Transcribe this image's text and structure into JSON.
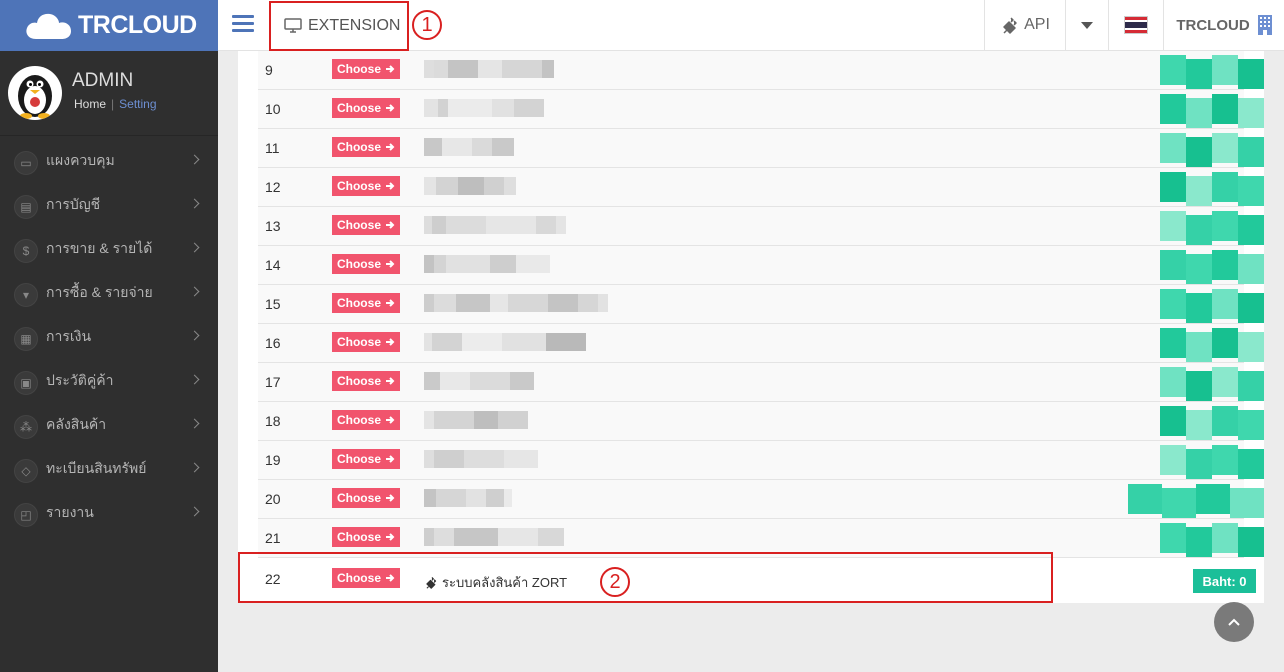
{
  "brand": {
    "logo_text": "TRCLOUD"
  },
  "topbar": {
    "extension_label": "EXTENSION",
    "api_label": "API",
    "user_label": "TRCLOUD"
  },
  "annotations": {
    "callout_1": "1",
    "callout_2": "2"
  },
  "profile": {
    "name": "ADMIN",
    "home_link": "Home",
    "separator": "|",
    "setting_link": "Setting"
  },
  "sidebar": {
    "items": [
      {
        "label": "แผงควบคุม",
        "icon": "monitor-icon"
      },
      {
        "label": "การบัญชี",
        "icon": "book-icon"
      },
      {
        "label": "การขาย & รายได้",
        "icon": "dollar-icon"
      },
      {
        "label": "การซื้อ & รายจ่าย",
        "icon": "cart-icon"
      },
      {
        "label": "การเงิน",
        "icon": "calendar-icon"
      },
      {
        "label": "ประวัติคู่ค้า",
        "icon": "contact-book-icon"
      },
      {
        "label": "คลังสินค้า",
        "icon": "cubes-icon"
      },
      {
        "label": "ทะเบียนสินทรัพย์",
        "icon": "diamond-icon"
      },
      {
        "label": "รายงาน",
        "icon": "report-icon"
      }
    ]
  },
  "extensions": {
    "choose_label": "Choose",
    "rows": [
      {
        "num": "9"
      },
      {
        "num": "10"
      },
      {
        "num": "11"
      },
      {
        "num": "12"
      },
      {
        "num": "13"
      },
      {
        "num": "14"
      },
      {
        "num": "15"
      },
      {
        "num": "16"
      },
      {
        "num": "17"
      },
      {
        "num": "18"
      },
      {
        "num": "19"
      },
      {
        "num": "20"
      },
      {
        "num": "21"
      }
    ],
    "last_row": {
      "num": "22",
      "name": "ระบบคลังสินค้า ZORT",
      "price": "Baht: 0"
    }
  },
  "colors": {
    "brand": "#4e74b8",
    "choose": "#f1546d",
    "badge": "#1bbf99",
    "highlight": "#d92020"
  }
}
